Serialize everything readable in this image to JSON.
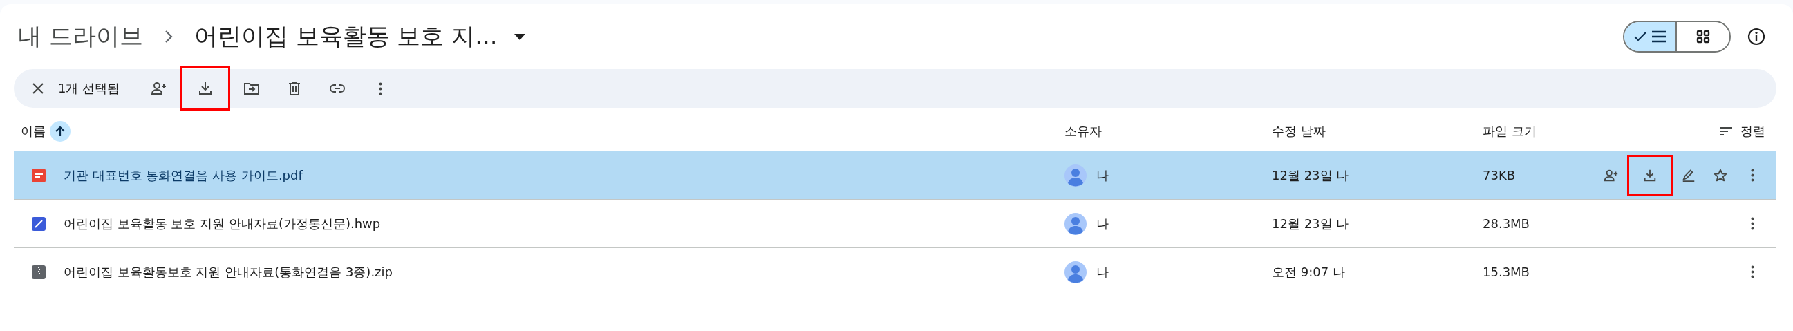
{
  "breadcrumb": [
    {
      "label": "내 드라이브"
    },
    {
      "label": "어린이집 보육활동 보호 지..."
    }
  ],
  "view_toggle": [
    {
      "kind": "list",
      "selected": true
    },
    {
      "kind": "grid",
      "selected": false
    }
  ],
  "selection_bar": {
    "count_label": "1개 선택됨",
    "actions": [
      {
        "kind": "share",
        "highlighted": false
      },
      {
        "kind": "download",
        "highlighted": true
      },
      {
        "kind": "move",
        "highlighted": false
      },
      {
        "kind": "trash",
        "highlighted": false
      },
      {
        "kind": "link",
        "highlighted": false
      },
      {
        "kind": "more",
        "highlighted": false
      }
    ]
  },
  "table": {
    "columns": [
      {
        "label": "이름",
        "sorted": true
      },
      {
        "label": "소유자",
        "sorted": false
      },
      {
        "label": "수정 날짜",
        "sorted": false
      },
      {
        "label": "파일 크기",
        "sorted": false
      }
    ],
    "sort_label": "정렬",
    "rows": [
      {
        "kind": "pdf",
        "name": "기관 대표번호 통화연결음 사용 가이드.pdf",
        "owner": "나",
        "modified": "12월 23일 나",
        "size": "73KB",
        "selected": true,
        "actions": [
          {
            "kind": "share",
            "highlighted": false
          },
          {
            "kind": "download",
            "highlighted": true
          },
          {
            "kind": "edit",
            "highlighted": false
          },
          {
            "kind": "star",
            "highlighted": false
          },
          {
            "kind": "more",
            "highlighted": false
          }
        ]
      },
      {
        "kind": "hwp",
        "name": "어린이집 보육활동 보호 지원 안내자료(가정통신문).hwp",
        "owner": "나",
        "modified": "12월 23일 나",
        "size": "28.3MB",
        "selected": false,
        "actions": [
          {
            "kind": "more",
            "highlighted": false
          }
        ]
      },
      {
        "kind": "zip",
        "name": "어린이집 보육활동보호 지원 안내자료(통화연결음 3종).zip",
        "owner": "나",
        "modified": "오전 9:07 나",
        "size": "15.3MB",
        "selected": false,
        "actions": [
          {
            "kind": "more",
            "highlighted": false
          }
        ]
      }
    ]
  }
}
